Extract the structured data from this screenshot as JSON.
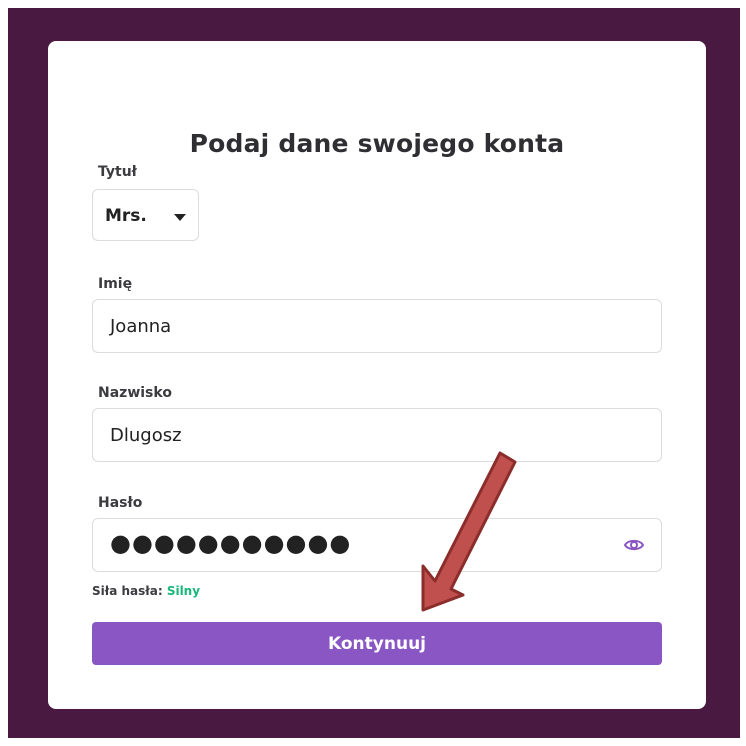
{
  "form": {
    "title": "Podaj dane swojego konta",
    "title_field": {
      "label": "Tytuł",
      "value": "Mrs."
    },
    "first_name": {
      "label": "Imię",
      "value": "Joanna"
    },
    "last_name": {
      "label": "Nazwisko",
      "value": "Dlugosz"
    },
    "password": {
      "label": "Hasło",
      "masked_value": "●●●●●●●●●●●"
    },
    "strength": {
      "label": "Siła hasła:",
      "value": "Silny"
    },
    "submit_label": "Kontynuuj"
  },
  "colors": {
    "background": "#4a1942",
    "button": "#8a56c3",
    "strength_ok": "#18b77a",
    "annotation_arrow": "#c0504d"
  },
  "icons": {
    "dropdown": "caret-down-icon",
    "password_toggle": "eye-icon"
  }
}
